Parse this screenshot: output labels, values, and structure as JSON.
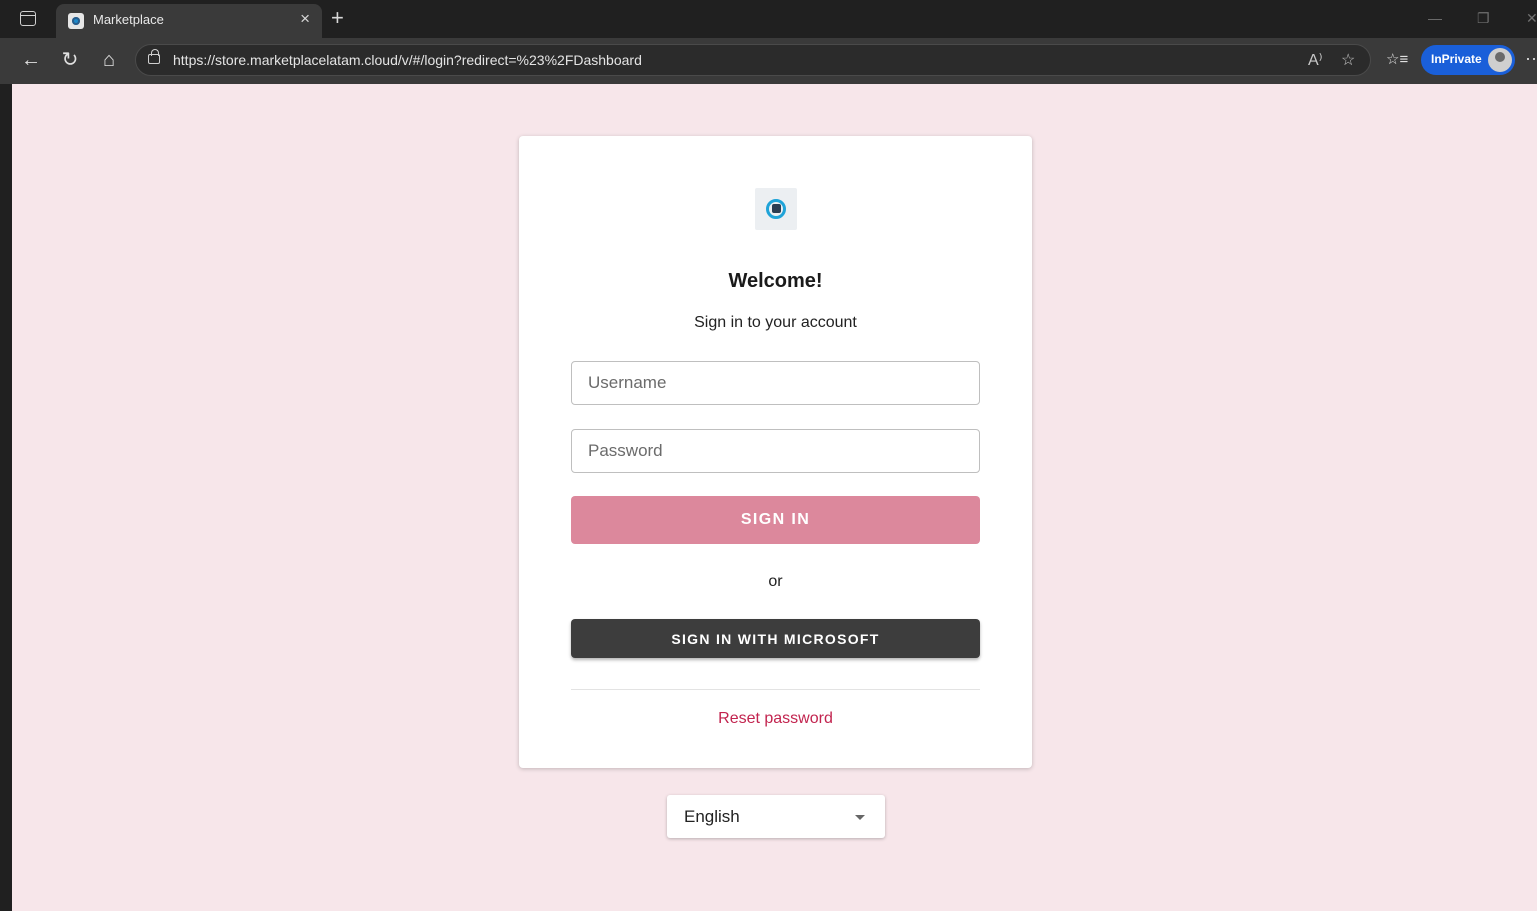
{
  "browser": {
    "tab_title": "Marketplace",
    "tab_close": "×",
    "new_tab": "+",
    "url": "https://store.marketplacelatam.cloud/v/#/login?redirect=%23%2FDashboard",
    "inprivate_label": "InPrivate",
    "icons": [
      "sidebar-icon",
      "back-arrow-icon",
      "refresh-icon",
      "home-icon",
      "lock-icon",
      "read-aloud-icon",
      "favorite-star-icon",
      "favorites-list-icon",
      "profile-avatar-icon",
      "more-icon"
    ],
    "back_glyph": "←",
    "refresh_glyph": "↻",
    "home_glyph": "⌂",
    "read_aloud_glyph": "A⁾",
    "star_glyph": "☆",
    "favorites_glyph": "☆≡",
    "more_glyph": "···",
    "minimize_glyph": "—",
    "restore_glyph": "❐",
    "close_glyph": "✕"
  },
  "login": {
    "welcome": "Welcome!",
    "subtitle": "Sign in to your account",
    "username_placeholder": "Username",
    "password_placeholder": "Password",
    "signin_label": "SIGN IN",
    "or_text": "or",
    "microsoft_label": "SIGN IN WITH MICROSOFT",
    "reset_label": "Reset password"
  },
  "language": {
    "selected": "English"
  },
  "colors": {
    "page_background": "#f7e6ea",
    "signin_button": "#dc889c",
    "microsoft_button": "#3d3d3d",
    "reset_link": "#c2244f",
    "inprivate_badge": "#1a5fd9"
  }
}
